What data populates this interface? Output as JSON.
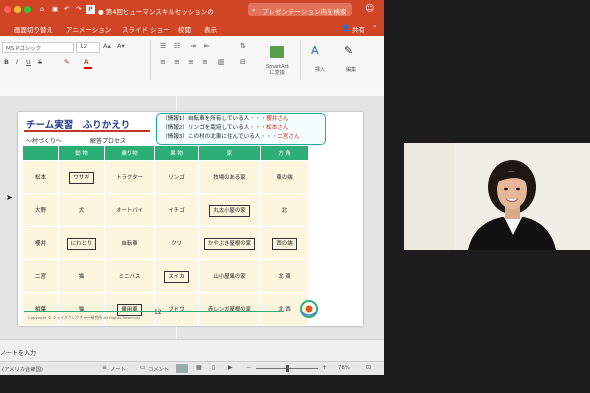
{
  "titlebar": {
    "app_icon": "powerpoint-icon",
    "title": "● 第4回ヒューマンスキルセッションの",
    "search_placeholder": "プレゼンテーション内を検索",
    "smile_icon": "smiley-icon"
  },
  "menu": {
    "items": [
      "画面切り替え",
      "アニメーション",
      "スライド ショー",
      "校閲",
      "表示"
    ],
    "share_label": "共有"
  },
  "ribbon": {
    "font_name": "MS Pゴシック",
    "font_size": "12",
    "smartart_label": "SmartArt\nに変換",
    "insert_label": "挿入",
    "edit_label": "編集"
  },
  "slide": {
    "title": "チーム実習　ふりかえり",
    "subtitle": "～村づくり～",
    "process_label": "解答プロセス",
    "info": [
      {
        "text": "（情報1）自転車を所有している人",
        "dots": "・・・",
        "name": "櫻井さん"
      },
      {
        "text": "（情報2）リンゴを栽培している人",
        "dots": "・・・",
        "name": "松本さん"
      },
      {
        "text": "（情報3）この村の北東に住んでいる人",
        "dots": "・・・",
        "name": "二宮さん"
      }
    ],
    "headers": [
      "",
      "動 物",
      "乗り物",
      "果 物",
      "家",
      "方 角"
    ],
    "rows": [
      {
        "name": "松本",
        "cells": [
          "ウサギ",
          "トラクター",
          "リンゴ",
          "牧場のある家",
          "東の端"
        ],
        "boxed": [
          true,
          false,
          false,
          false,
          false
        ]
      },
      {
        "name": "大野",
        "cells": [
          "犬",
          "オートバイ",
          "イチゴ",
          "丸太小屋の家",
          "北"
        ],
        "boxed": [
          false,
          false,
          false,
          true,
          false
        ]
      },
      {
        "name": "櫻井",
        "cells": [
          "にわとり",
          "自転車",
          "クリ",
          "かやぶき屋根の家",
          "西の端"
        ],
        "boxed": [
          true,
          false,
          false,
          true,
          true
        ]
      },
      {
        "name": "二宮",
        "cells": [
          "猫",
          "ミニバス",
          "スイカ",
          "山小屋風の家",
          "北 東"
        ],
        "boxed": [
          false,
          false,
          true,
          false,
          false
        ]
      },
      {
        "name": "相葉",
        "cells": [
          "猫",
          "乗用車",
          "ブドウ",
          "赤レンガ屋根の家",
          "北 西"
        ],
        "boxed": [
          false,
          true,
          false,
          false,
          false
        ]
      }
    ],
    "page_number": "12",
    "footer": "Copyright © シャイボクレクチャー研究所 All Rights Reserved"
  },
  "notes": {
    "placeholder": "ノートを入力"
  },
  "status": {
    "language": "(アメリカ合衆国)",
    "notes_label": "ノート",
    "comments_label": "コメント",
    "zoom": "78%"
  },
  "colors": {
    "ppt_orange": "#d04525",
    "table_header": "#2cae76",
    "table_cell": "#fdf6de",
    "title_blue": "#1f3a8a",
    "info_border": "#2aa79b"
  }
}
